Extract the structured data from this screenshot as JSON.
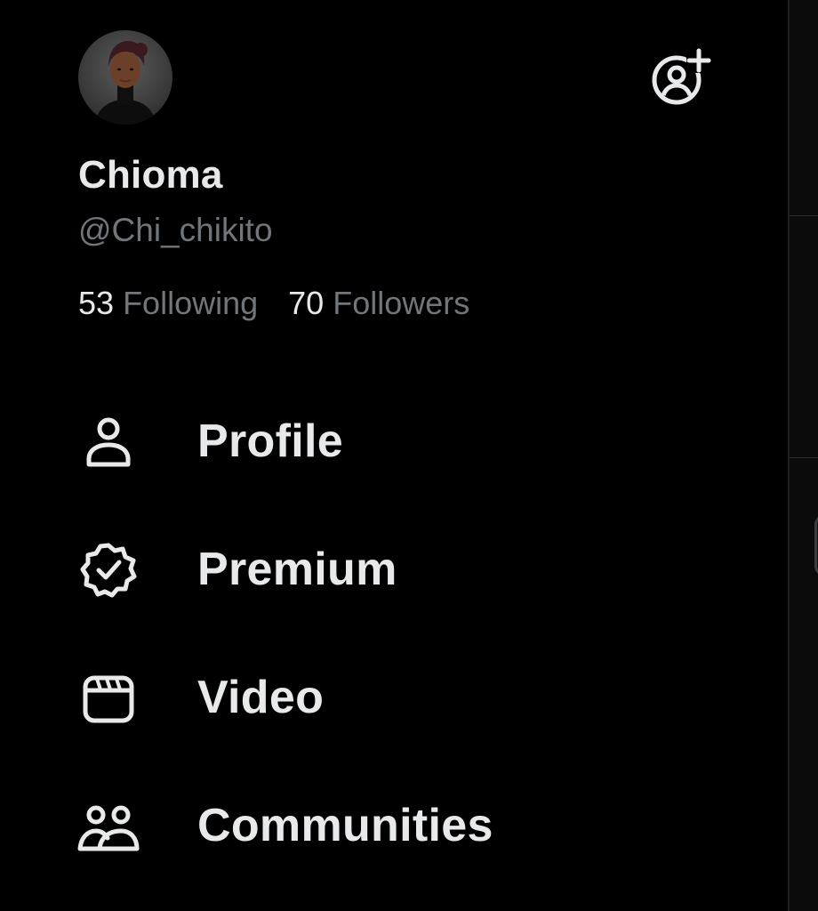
{
  "user": {
    "display_name": "Chioma",
    "handle": "@Chi_chikito",
    "avatar_icon": "profile-photo"
  },
  "header": {
    "add_account_icon": "add-account-icon"
  },
  "stats": {
    "following_count": "53",
    "following_label": "Following",
    "followers_count": "70",
    "followers_label": "Followers"
  },
  "menu": {
    "items": [
      {
        "label": "Profile",
        "icon": "person-icon"
      },
      {
        "label": "Premium",
        "icon": "verified-badge-icon"
      },
      {
        "label": "Video",
        "icon": "video-clapper-icon"
      },
      {
        "label": "Communities",
        "icon": "communities-icon"
      }
    ]
  },
  "colors": {
    "background": "#000000",
    "primary_text": "#e7e9ea",
    "secondary_text": "#71767b"
  }
}
